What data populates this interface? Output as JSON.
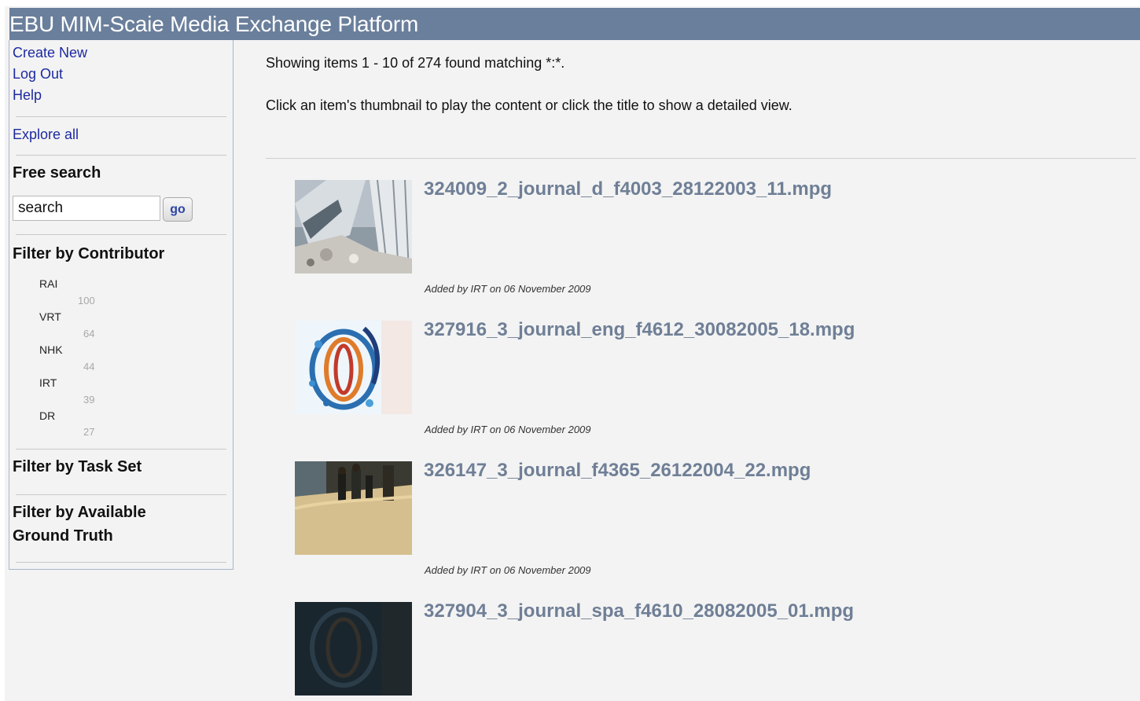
{
  "header": {
    "title": "EBU MIM-Scaie Media Exchange Platform"
  },
  "sidebar": {
    "links": [
      "Create New",
      "Log Out",
      "Help"
    ],
    "explore_all": "Explore all",
    "free_search": {
      "heading": "Free search",
      "input_value": "search",
      "go_label": "go"
    },
    "contributor_filter": {
      "heading": "Filter by Contributor",
      "items": [
        {
          "name": "RAI",
          "count": "100"
        },
        {
          "name": "VRT",
          "count": "64"
        },
        {
          "name": "NHK",
          "count": "44"
        },
        {
          "name": "IRT",
          "count": "39"
        },
        {
          "name": "DR",
          "count": "27"
        }
      ]
    },
    "task_set_heading": "Filter by Task Set",
    "ground_truth_heading_line1": "Filter by Available",
    "ground_truth_heading_line2": "Ground Truth"
  },
  "main": {
    "results_summary": "Showing items 1 - 10 of 274 found matching *:*.",
    "instructions": "Click an item's thumbnail to play the content or click the title to show a detailed view.",
    "items": [
      {
        "title": "324009_2_journal_d_f4003_28122003_11.mpg",
        "meta": "Added by IRT on 06 November 2009",
        "thumb": "collapsed-building-thumbnail"
      },
      {
        "title": "327916_3_journal_eng_f4612_30082005_18.mpg",
        "meta": "Added by IRT on 06 November 2009",
        "thumb": "swirl-logo-thumbnail"
      },
      {
        "title": "326147_3_journal_f4365_26122004_22.mpg",
        "meta": "Added by IRT on 06 November 2009",
        "thumb": "people-on-beach-thumbnail"
      },
      {
        "title": "327904_3_journal_spa_f4610_28082005_01.mpg",
        "meta": "",
        "thumb": "dark-swirl-thumbnail"
      }
    ]
  },
  "colors": {
    "header_bg": "#6a7f9b",
    "link": "#1d2aa0",
    "item_title": "#6f7f96",
    "page_bg": "#f3f3f3"
  }
}
